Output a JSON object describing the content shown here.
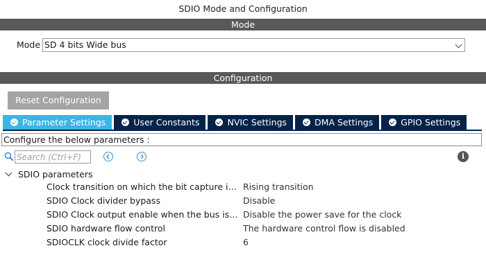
{
  "window": {
    "title": "SDIO Mode and Configuration"
  },
  "mode_section": {
    "header": "Mode",
    "mode_label": "Mode",
    "mode_value": "SD 4 bits Wide bus"
  },
  "config_section": {
    "header": "Configuration",
    "reset_button": "Reset Configuration",
    "tabs": [
      {
        "label": "Parameter Settings",
        "active": true
      },
      {
        "label": "User Constants",
        "active": false
      },
      {
        "label": "NVIC Settings",
        "active": false
      },
      {
        "label": "DMA Settings",
        "active": false
      },
      {
        "label": "GPIO Settings",
        "active": false
      }
    ],
    "hint": "Configure the below parameters :",
    "search": {
      "placeholder": "Search (Ctrl+F)",
      "value": ""
    },
    "group": {
      "title": "SDIO parameters",
      "params": [
        {
          "name": "Clock transition on which the bit capture is made",
          "value": "Rising transition"
        },
        {
          "name": "SDIO Clock divider bypass",
          "value": "Disable"
        },
        {
          "name": "SDIO Clock output enable when the bus is idle",
          "value": "Disable the power save for the clock"
        },
        {
          "name": "SDIO hardware flow control",
          "value": "The hardware control flow is disabled"
        },
        {
          "name": "SDIOCLK clock divide factor",
          "value": "6"
        }
      ]
    }
  },
  "colors": {
    "section_bar": "#58595b",
    "tab_active": "#3cb4e6",
    "tab_inactive": "#03234b",
    "button_gray": "#a3a4a6"
  },
  "icons": [
    "check-circle-icon",
    "search-icon",
    "arrow-left-circle-icon",
    "arrow-right-circle-icon",
    "info-icon",
    "chevron-down-icon"
  ]
}
